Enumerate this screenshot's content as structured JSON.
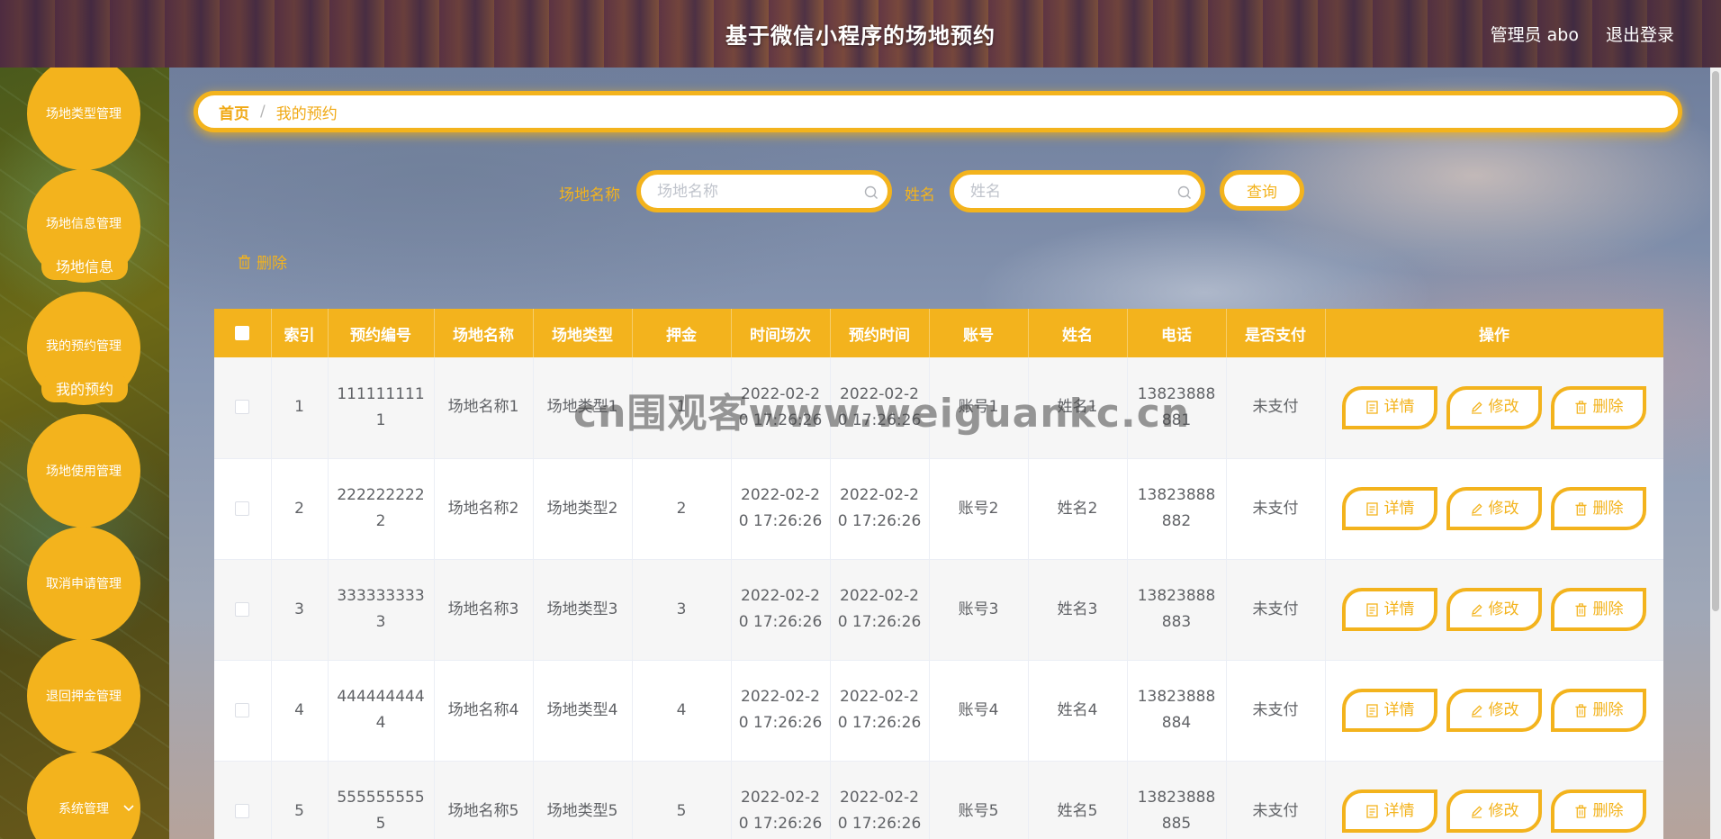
{
  "header": {
    "title": "基于微信小程序的场地预约",
    "admin": "管理员 abo",
    "logout": "退出登录"
  },
  "sidebar": {
    "items": [
      {
        "label": "场地类型管理"
      },
      {
        "label": "场地信息管理",
        "sub": "场地信息"
      },
      {
        "label": "我的预约管理",
        "sub": "我的预约"
      },
      {
        "label": "场地使用管理"
      },
      {
        "label": "取消申请管理"
      },
      {
        "label": "退回押金管理"
      },
      {
        "label": "系统管理"
      }
    ]
  },
  "breadcrumb": {
    "home": "首页",
    "separator": "/",
    "current": "我的预约"
  },
  "search": {
    "field1_label": "场地名称",
    "field1_placeholder": "场地名称",
    "field2_label": "姓名",
    "field2_placeholder": "姓名",
    "query_button": "查询"
  },
  "actions": {
    "delete": "删除"
  },
  "table": {
    "headers": [
      "索引",
      "预约编号",
      "场地名称",
      "场地类型",
      "押金",
      "时间场次",
      "预约时间",
      "账号",
      "姓名",
      "电话",
      "是否支付",
      "操作"
    ],
    "ops": {
      "detail": "详情",
      "edit": "修改",
      "delete": "删除"
    },
    "rows": [
      [
        "1",
        "1111111111",
        "场地名称1",
        "场地类型1",
        "1",
        "2022-02-20 17:26:26",
        "2022-02-20 17:26:26",
        "账号1",
        "姓名1",
        "13823888881",
        "未支付"
      ],
      [
        "2",
        "2222222222",
        "场地名称2",
        "场地类型2",
        "2",
        "2022-02-20 17:26:26",
        "2022-02-20 17:26:26",
        "账号2",
        "姓名2",
        "13823888882",
        "未支付"
      ],
      [
        "3",
        "3333333333",
        "场地名称3",
        "场地类型3",
        "3",
        "2022-02-20 17:26:26",
        "2022-02-20 17:26:26",
        "账号3",
        "姓名3",
        "13823888883",
        "未支付"
      ],
      [
        "4",
        "4444444444",
        "场地名称4",
        "场地类型4",
        "4",
        "2022-02-20 17:26:26",
        "2022-02-20 17:26:26",
        "账号4",
        "姓名4",
        "13823888884",
        "未支付"
      ],
      [
        "5",
        "5555555555",
        "场地名称5",
        "场地类型5",
        "5",
        "2022-02-20 17:26:26",
        "2022-02-20 17:26:26",
        "账号5",
        "姓名5",
        "13823888885",
        "未支付"
      ]
    ]
  },
  "watermark": "cn围观客www.weiguankc.cn",
  "colors": {
    "accent": "#f3b31d",
    "text": "#606266"
  }
}
